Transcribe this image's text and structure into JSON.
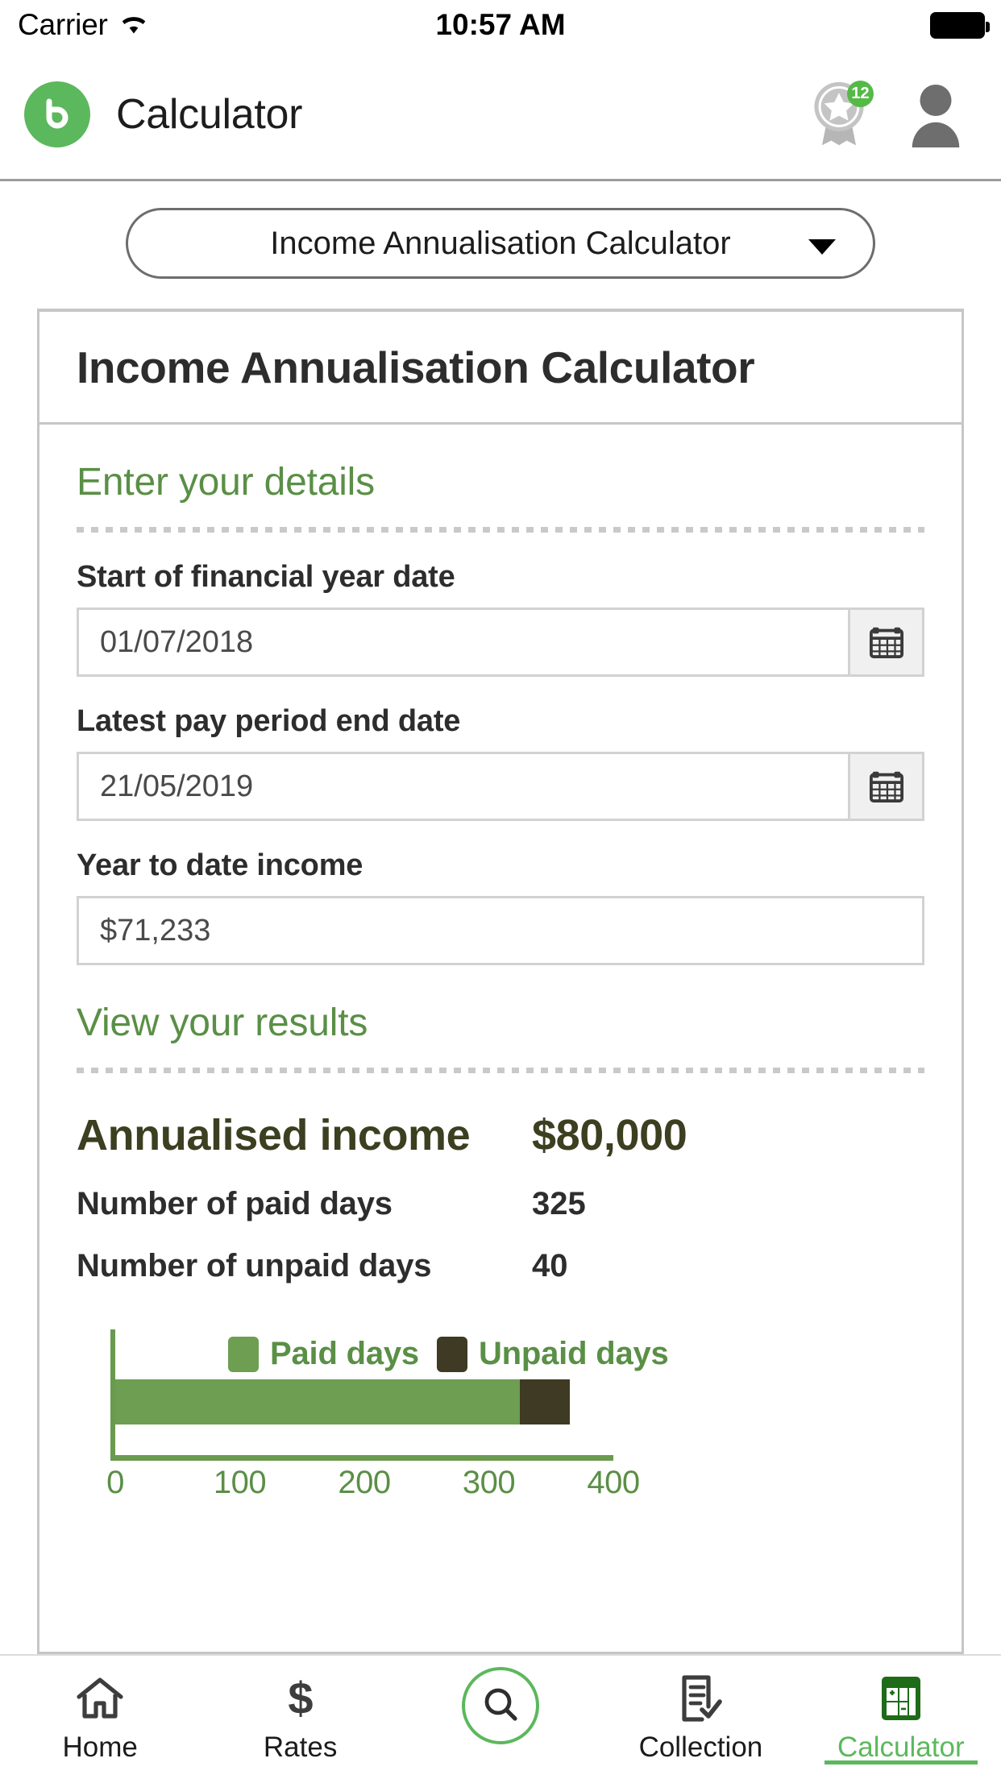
{
  "status_bar": {
    "carrier": "Carrier",
    "wifi_icon": "wifi-icon",
    "time": "10:57 AM",
    "battery_icon": "battery-full-icon"
  },
  "header": {
    "logo_icon": "brand-b-logo",
    "title": "Calculator",
    "award_icon": "award-ribbon-icon",
    "award_count": "12",
    "avatar_icon": "user-avatar-icon"
  },
  "selector": {
    "value": "Income Annualisation Calculator",
    "caret_icon": "chevron-down-icon"
  },
  "card": {
    "title": "Income Annualisation Calculator",
    "details_section": {
      "heading": "Enter your details",
      "fields": [
        {
          "label": "Start of financial year date",
          "value": "01/07/2018",
          "icon": "calendar-icon",
          "has_calendar": true
        },
        {
          "label": "Latest pay period end date",
          "value": "21/05/2019",
          "icon": "calendar-icon",
          "has_calendar": true
        },
        {
          "label": "Year to date income",
          "value": "$71,233",
          "has_calendar": false
        }
      ]
    },
    "results_section": {
      "heading": "View your results",
      "primary": {
        "label": "Annualised income",
        "value": "$80,000"
      },
      "rows": [
        {
          "label": "Number of paid days",
          "value": "325"
        },
        {
          "label": "Number of unpaid days",
          "value": "40"
        }
      ]
    }
  },
  "chart_data": {
    "type": "bar",
    "orientation": "horizontal",
    "stacked": true,
    "title": "",
    "xlabel": "",
    "ylabel": "",
    "categories": [
      "Days"
    ],
    "series": [
      {
        "name": "Paid days",
        "values": [
          325
        ],
        "color": "#6d9e51"
      },
      {
        "name": "Unpaid days",
        "values": [
          40
        ],
        "color": "#3e3a23"
      }
    ],
    "legend": [
      "Paid days",
      "Unpaid days"
    ],
    "legend_position": "top",
    "xlim": [
      0,
      400
    ],
    "xticks": [
      0,
      100,
      200,
      300,
      400
    ],
    "xtick_labels": [
      "0",
      "100",
      "200",
      "300",
      "400"
    ],
    "grid": false,
    "axis_color": "#6a9a4e",
    "tick_label_color": "#5a8f46"
  },
  "tabbar": {
    "items": [
      {
        "label": "Home",
        "icon": "home-icon",
        "active": false
      },
      {
        "label": "Rates",
        "icon": "dollar-icon",
        "active": false
      },
      {
        "label": "",
        "icon": "search-icon",
        "active": false
      },
      {
        "label": "Collection",
        "icon": "document-check-icon",
        "active": false
      },
      {
        "label": "Calculator",
        "icon": "calculator-icon",
        "active": true
      }
    ]
  },
  "colors": {
    "brand_green": "#5cb85c",
    "heading_green": "#5a8f46",
    "paid_green": "#6d9e51",
    "unpaid_olive": "#3e3a23",
    "result_olive": "#3c3f20"
  }
}
